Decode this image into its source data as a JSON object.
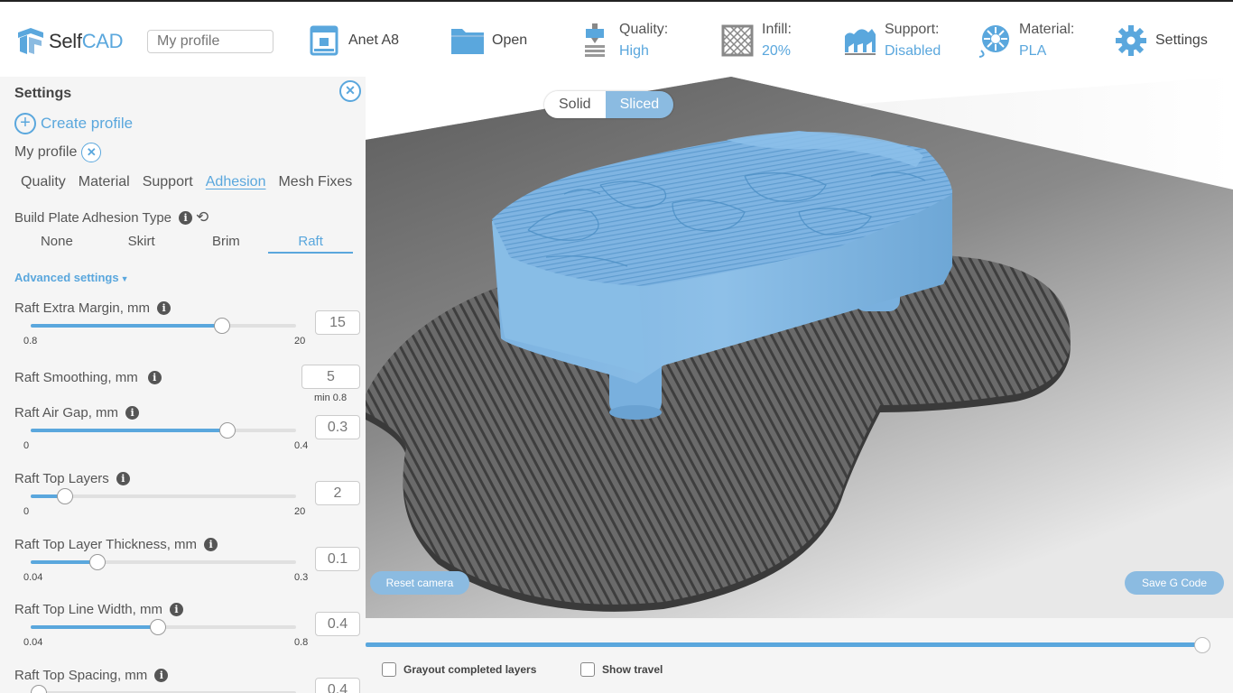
{
  "app": {
    "logo_prefix": "Self",
    "logo_suffix": "CAD",
    "profile_placeholder": "My profile"
  },
  "toolbar": {
    "printer": "Anet A8",
    "open": "Open",
    "quality_label": "Quality:",
    "quality_value": "High",
    "infill_label": "Infill:",
    "infill_value": "20%",
    "support_label": "Support:",
    "support_value": "Disabled",
    "material_label": "Material:",
    "material_value": "PLA",
    "settings": "Settings"
  },
  "panel": {
    "title": "Settings",
    "close_glyph": "✕",
    "create_profile": "Create profile",
    "my_profile": "My profile",
    "tabs": [
      "Quality",
      "Material",
      "Support",
      "Adhesion",
      "Mesh Fixes"
    ],
    "active_tab": "Adhesion",
    "adhesion_type_label": "Build Plate Adhesion Type",
    "adhesion_options": [
      "None",
      "Skirt",
      "Brim",
      "Raft"
    ],
    "adhesion_selected": "Raft",
    "advanced_settings": "Advanced settings",
    "raft_settings": [
      {
        "name": "Raft Extra Margin, mm",
        "min": "0.8",
        "max": "20",
        "value": "15",
        "fraction": 0.72,
        "slider": true
      },
      {
        "name": "Raft Smoothing, mm",
        "value": "5",
        "hint": "min 0.8",
        "slider": false
      },
      {
        "name": "Raft Air Gap, mm",
        "min": "0",
        "max": "0.4",
        "value": "0.3",
        "fraction": 0.74,
        "slider": true
      },
      {
        "name": "Raft Top Layers",
        "min": "0",
        "max": "20",
        "value": "2",
        "fraction": 0.13,
        "slider": true
      },
      {
        "name": "Raft Top Layer Thickness, mm",
        "min": "0.04",
        "max": "0.3",
        "value": "0.1",
        "fraction": 0.25,
        "slider": true
      },
      {
        "name": "Raft Top Line Width, mm",
        "min": "0.04",
        "max": "0.8",
        "value": "0.4",
        "fraction": 0.48,
        "slider": true
      },
      {
        "name": "Raft Top Spacing, mm",
        "value": "0.4",
        "slider": true,
        "fraction": 0.03,
        "min": "",
        "max": ""
      }
    ]
  },
  "viewport": {
    "view_modes": [
      "Solid",
      "Sliced"
    ],
    "active_view": "Sliced",
    "reset_camera": "Reset camera",
    "save_gcode": "Save G Code"
  },
  "layers": {
    "position_fraction": 1.0,
    "grayout_label": "Grayout completed layers",
    "show_travel_label": "Show travel"
  },
  "colors": {
    "accent": "#5aa7dd",
    "pill": "#8bbbe1",
    "model": "#7fb4e2",
    "raft": "#5a5a5a",
    "panel_bg": "#f5f5f5"
  }
}
